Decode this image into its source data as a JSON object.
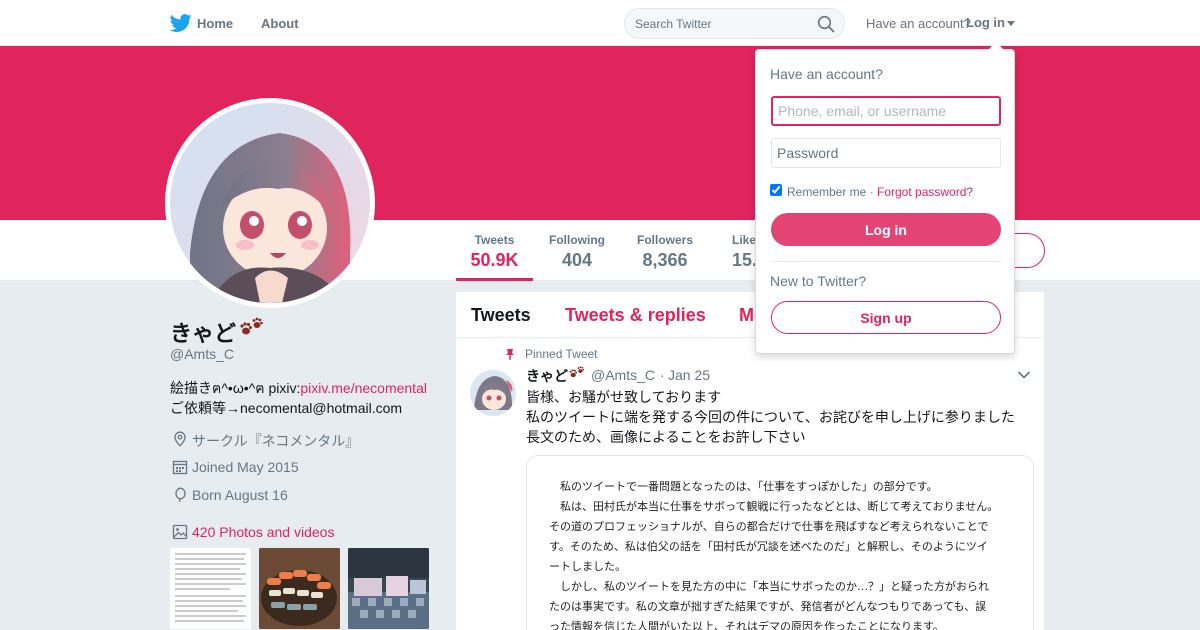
{
  "colors": {
    "accent": "#e0245e",
    "banner": "#e0245e",
    "background": "#e6ecf0",
    "logo": "#1da1f2"
  },
  "topnav": {
    "logo_icon": "twitter-bird-icon",
    "home_label": "Home",
    "about_label": "About",
    "search_placeholder": "Search Twitter",
    "search_icon": "search-icon",
    "have_account": "Have an account?",
    "login_label": "Log in"
  },
  "profile": {
    "name": "きゃど",
    "name_emoji_icon": "paw-prints-icon",
    "handle": "@Amts_C",
    "bio_line1_text": "絵描きฅ^•ω•^ฅ pixiv:",
    "bio_line1_link": "pixiv.me/necomental",
    "bio_line2": "ご依頼等→necomental@hotmail.com",
    "location": "サークル『ネコメンタル』",
    "joined": "Joined May 2015",
    "birthday": "Born August 16",
    "photos_label": "420 Photos and videos"
  },
  "stats": [
    {
      "label": "Tweets",
      "value": "50.9K",
      "active": true
    },
    {
      "label": "Following",
      "value": "404"
    },
    {
      "label": "Followers",
      "value": "8,366"
    },
    {
      "label": "Likes",
      "value": "15.1K"
    }
  ],
  "timeline": {
    "tabs": [
      "Tweets",
      "Tweets & replies",
      "Media"
    ],
    "pinned_label": "Pinned Tweet",
    "tweet": {
      "name": "きゃど",
      "handle": "@Amts_C",
      "dot": "·",
      "time": "Jan 25",
      "lines": [
        "皆様、お騒がせ致しております",
        "私のツイートに端を発する今回の件について、お詫びを申し上げに参りました",
        "長文のため、画像によることをお許し下さい"
      ],
      "media_lines": [
        "　私のツイートで一番問題となったのは、「仕事をすっぽかした」の部分です。",
        "　私は、田村氏が本当に仕事をサボって観戦に行ったなどとは、断じて考えておりません。",
        "その道のプロフェッショナルが、自らの都合だけで仕事を飛ばすなど考えられないことで",
        "す。そのため、私は伯父の話を「田村氏が冗談を述べたのだ」と解釈し、そのようにツイ",
        "ートしました。",
        "　しかし、私のツイートを見た方の中に「本当にサボったのか…？」と疑った方がおられ",
        "たのは事実です。私の文章が拙すぎた結果ですが、発信者がどんなつもりであっても、誤",
        "った情報を信じた人間がいた以上、それはデマの原因を作ったことになります。"
      ]
    }
  },
  "login_dropdown": {
    "title": "Have an account?",
    "username_placeholder": "Phone, email, or username",
    "password_placeholder": "Password",
    "remember_label": "Remember me ·",
    "forgot_label": "Forgot password?",
    "login_button": "Log in",
    "new_label": "New to Twitter?",
    "signup_button": "Sign up"
  }
}
